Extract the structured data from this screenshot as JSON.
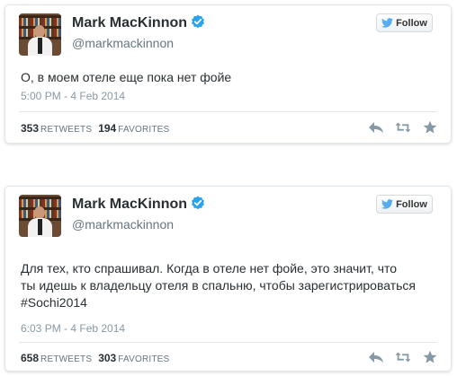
{
  "tweets": [
    {
      "display_name": "Mark MacKinnon",
      "username": "@markmackinnon",
      "follow_label": "Follow",
      "text": "О, в моем отеле еще пока нет фойе",
      "timestamp": "5:00 PM - 4 Feb 2014",
      "retweets_count": "353",
      "retweets_label": "RETWEETS",
      "favorites_count": "194",
      "favorites_label": "FAVORITES"
    },
    {
      "display_name": "Mark MacKinnon",
      "username": "@markmackinnon",
      "follow_label": "Follow",
      "text": "Для тех, кто спрашивал. Когда в отеле нет фойе, это значит, что\nты идешь к владельцу отеля в спальню, чтобы зарегистрироваться\n#Sochi2014",
      "timestamp": "6:03 PM - 4 Feb 2014",
      "retweets_count": "658",
      "retweets_label": "RETWEETS",
      "favorites_count": "303",
      "favorites_label": "FAVORITES"
    }
  ],
  "colors": {
    "verified": "#2aa3ef",
    "bird": "#55acee",
    "action_icon": "#8899a6"
  },
  "icons": [
    "verified-badge-icon",
    "twitter-bird-icon",
    "reply-icon",
    "retweet-icon",
    "favorite-star-icon"
  ]
}
